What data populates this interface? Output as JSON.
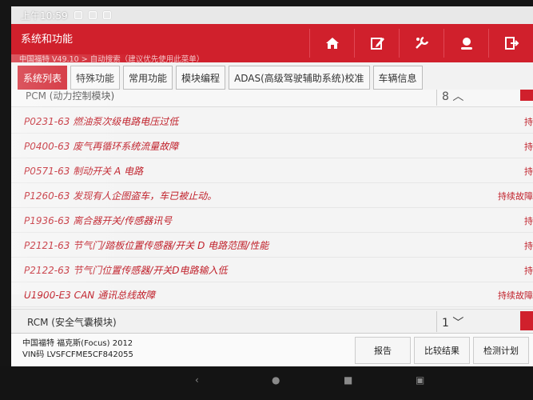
{
  "status_bar": {
    "time": "上午10:59"
  },
  "header": {
    "title": "系统和功能"
  },
  "breadcrumb": "中国福特 V49.10 > 自动搜索（建议优先使用此菜单）",
  "tabs": [
    {
      "label": "系统列表",
      "active": true
    },
    {
      "label": "特殊功能",
      "active": false
    },
    {
      "label": "常用功能",
      "active": false
    },
    {
      "label": "模块编程",
      "active": false
    },
    {
      "label": "ADAS(高级驾驶辅助系统)校准",
      "active": false
    },
    {
      "label": "车辆信息",
      "active": false
    }
  ],
  "top_module": {
    "name": "PCM (动力控制模块)",
    "count": "8"
  },
  "faults": [
    {
      "code": "P0231-63 燃油泵次级电路电压过低",
      "status": "持"
    },
    {
      "code": "P0400-63 废气再循环系统流量故障",
      "status": "持"
    },
    {
      "code": "P0571-63 制动开关 A 电路",
      "status": "持"
    },
    {
      "code": "P1260-63 发现有人企图盗车，车已被止动。",
      "status": "持续故障"
    },
    {
      "code": "P1936-63 离合器开关/传感器讯号",
      "status": "持"
    },
    {
      "code": "P2121-63 节气门/踏板位置传感器/开关 D 电路范围/性能",
      "status": "持"
    },
    {
      "code": "P2122-63 节气门位置传感器/开关D电路输入低",
      "status": "持"
    },
    {
      "code": "U1900-E3 CAN 通讯总线故障",
      "status": "持续故障"
    }
  ],
  "bottom_module": {
    "name": "RCM (安全气囊模块)",
    "count": "1"
  },
  "footer": {
    "vehicle": "中国福特 福克斯(Focus) 2012",
    "vin": "VIN码 LVSFCFME5CF842055",
    "buttons": [
      "报告",
      "比较结果",
      "检测计划"
    ]
  },
  "colors": {
    "accent": "#d0202c",
    "fault_text": "#c0202a"
  }
}
